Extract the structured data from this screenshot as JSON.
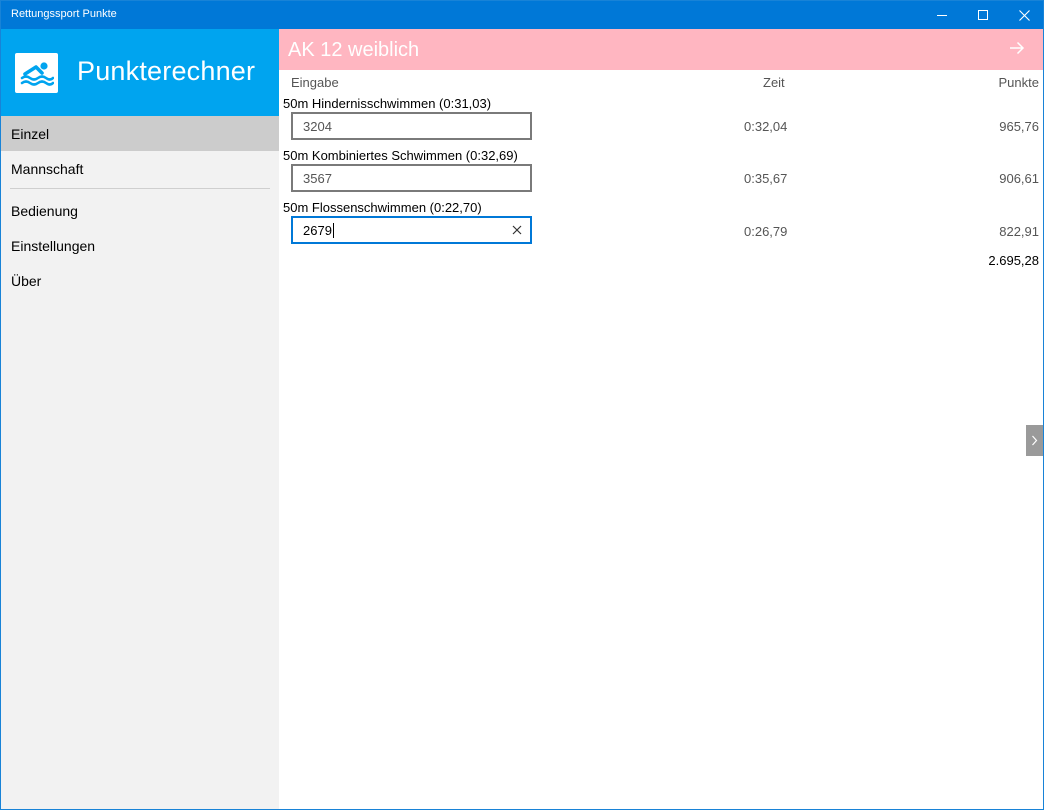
{
  "window": {
    "title": "Rettungssport Punkte"
  },
  "app": {
    "title": "Punkterechner"
  },
  "nav": {
    "items": [
      {
        "label": "Einzel"
      },
      {
        "label": "Mannschaft"
      },
      {
        "label": "Bedienung"
      },
      {
        "label": "Einstellungen"
      },
      {
        "label": "Über"
      }
    ]
  },
  "banner": {
    "title": "AK 12 weiblich"
  },
  "columns": {
    "input": "Eingabe",
    "time": "Zeit",
    "points": "Punkte"
  },
  "rows": [
    {
      "label": "50m Hindernisschwimmen (0:31,03)",
      "input": "3204",
      "time": "0:32,04",
      "points": "965,76"
    },
    {
      "label": "50m Kombiniertes Schwimmen (0:32,69)",
      "input": "3567",
      "time": "0:35,67",
      "points": "906,61"
    },
    {
      "label": "50m Flossenschwimmen (0:22,70)",
      "input": "2679",
      "time": "0:26,79",
      "points": "822,91"
    }
  ],
  "total": "2.695,28",
  "colors": {
    "titlebar": "#0078d7",
    "sidebar_header": "#00a4ef",
    "banner": "#ffb6c1",
    "focus": "#0078d7"
  }
}
